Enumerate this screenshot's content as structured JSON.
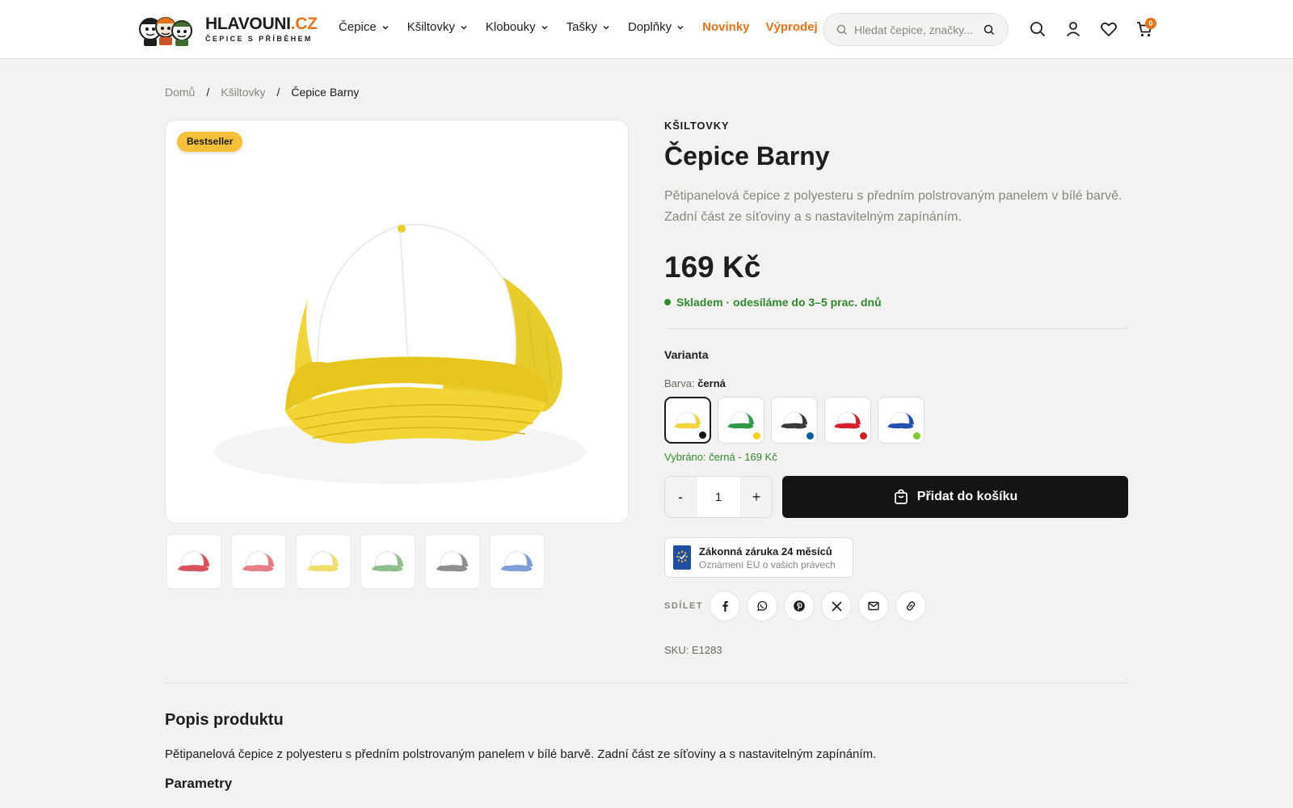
{
  "header": {
    "logo_main": "HLAVOUNI",
    "logo_tld": ".CZ",
    "logo_sub": "ČEPICE S PŘÍBĚHEM",
    "nav": [
      {
        "label": "Čepice",
        "dropdown": true
      },
      {
        "label": "Kšiltovky",
        "dropdown": true
      },
      {
        "label": "Klobouky",
        "dropdown": true
      },
      {
        "label": "Tašky",
        "dropdown": true
      },
      {
        "label": "Doplňky",
        "dropdown": true
      }
    ],
    "nav_accent": [
      {
        "label": "Novinky"
      },
      {
        "label": "Výprodej"
      }
    ],
    "search_placeholder": "Hledat čepice, značky...",
    "cart_count": "0",
    "accent_color": "#e5731a"
  },
  "breadcrumb": {
    "items": [
      "Domů",
      "Kšiltovky"
    ],
    "current": "Čepice Barny",
    "separator": "/"
  },
  "gallery": {
    "badge": "Bestseller",
    "main_icon": "yellow-trucker-cap-image",
    "thumbnails": [
      {
        "color": "#d9535f"
      },
      {
        "color": "#e67e86"
      },
      {
        "color": "#eede6c"
      },
      {
        "color": "#8fbf8a"
      },
      {
        "color": "#8f8f8f"
      },
      {
        "color": "#7f9ed6"
      }
    ]
  },
  "product": {
    "category": "KŠILTOVKY",
    "title": "Čepice Barny",
    "description": "Pětipanelová čepice z polyesteru s předním polstrovaným panelem v bílé barvě. Zadní část ze síťoviny a s nastavitelným zapínáním.",
    "price": "169 Kč",
    "stock": "Skladem · odesíláme do 3–5 prac. dnů",
    "variant_heading": "Varianta",
    "color_label": "Barva:",
    "color_value": "černá",
    "swatches": [
      {
        "cap": "#f0d43a",
        "dot": "#151515",
        "selected": true
      },
      {
        "cap": "#2f9a48",
        "dot": "#f2d20f",
        "selected": false
      },
      {
        "cap": "#3a3a3a",
        "dot": "#0f5aa6",
        "selected": false
      },
      {
        "cap": "#d61f2c",
        "dot": "#d61f2c",
        "selected": false
      },
      {
        "cap": "#2450b0",
        "dot": "#7fc92e",
        "selected": false
      }
    ],
    "selected_text": "Vybráno: černá - 169 Kč",
    "quantity": "1",
    "qty_minus": "-",
    "qty_plus": "+",
    "add_to_cart": "Přidat do košíku",
    "warranty_title": "Zákonná záruka 24 měsíců",
    "warranty_sub": "Oznámení EU o vašich právech",
    "share_label": "SDÍLET",
    "share_icons": [
      "facebook-icon",
      "whatsapp-icon",
      "pinterest-icon",
      "x-icon",
      "mail-icon",
      "link-icon"
    ],
    "sku": "SKU: E1283"
  },
  "description_section": {
    "heading": "Popis produktu",
    "text": "Pětipanelová čepice z polyesteru s předním polstrovaným panelem v bílé barvě. Zadní část ze síťoviny a s nastavitelným zapínáním.",
    "params_heading": "Parametry"
  }
}
